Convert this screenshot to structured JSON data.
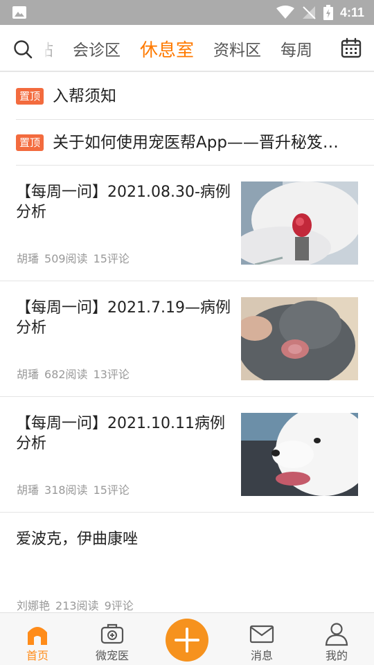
{
  "status_bar": {
    "time": "4:11"
  },
  "top_tabs": [
    {
      "label": "帖"
    },
    {
      "label": "会诊区"
    },
    {
      "label": "休息室",
      "active": true
    },
    {
      "label": "资料区"
    },
    {
      "label": "每周"
    }
  ],
  "pinned": [
    {
      "badge": "置顶",
      "title": "入帮须知"
    },
    {
      "badge": "置顶",
      "title": "关于如何使用宠医帮App——晋升秘笈…"
    }
  ],
  "posts": [
    {
      "title": "【每周一问】2021.08.30-病例分析",
      "author": "胡璠",
      "reads": "509阅读",
      "comments": "15评论",
      "thumb": "dog-nose-wound-photo"
    },
    {
      "title": "【每周一问】2021.7.19—病例分析",
      "author": "胡璠",
      "reads": "682阅读",
      "comments": "13评论",
      "thumb": "cat-eye-photo"
    },
    {
      "title": "【每周一问】2021.10.11病例分析",
      "author": "胡璠",
      "reads": "318阅读",
      "comments": "15评论",
      "thumb": "white-dog-photo"
    },
    {
      "title": "爱波克，伊曲康唑",
      "author": "刘娜艳",
      "reads": "213阅读",
      "comments": "9评论"
    }
  ],
  "bottom_tabs": [
    {
      "label": "首页",
      "icon": "home-icon",
      "active": true
    },
    {
      "label": "微宠医",
      "icon": "medical-kit-icon"
    },
    {
      "label": "",
      "icon": "plus-icon"
    },
    {
      "label": "消息",
      "icon": "mail-icon"
    },
    {
      "label": "我的",
      "icon": "user-icon"
    }
  ],
  "colors": {
    "accent": "#ff7a00",
    "badge": "#f36b3e",
    "fab": "#f6921e",
    "status_bar": "#ababab"
  }
}
